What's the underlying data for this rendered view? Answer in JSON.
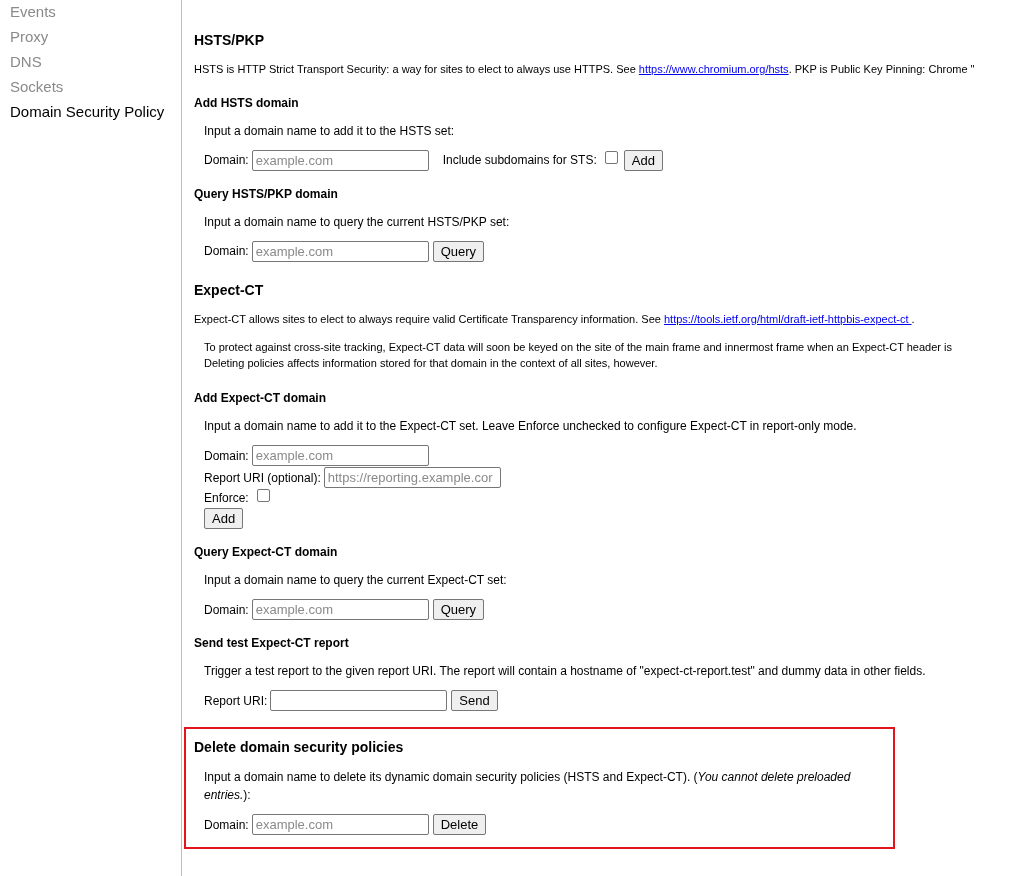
{
  "sidebar": {
    "items": [
      {
        "label": "Events",
        "selected": false
      },
      {
        "label": "Proxy",
        "selected": false
      },
      {
        "label": "DNS",
        "selected": false
      },
      {
        "label": "Sockets",
        "selected": false
      },
      {
        "label": "Domain Security Policy",
        "selected": true
      }
    ]
  },
  "sections": [
    {
      "highlighted": false,
      "blocks": [
        {
          "kind": "h2",
          "text": "HSTS/PKP"
        },
        {
          "kind": "intro",
          "before": "HSTS is HTTP Strict Transport Security: a way for sites to elect to always use HTTPS. See ",
          "link": "https://www.chromium.org/hsts",
          "after": ". PKP is Public Key Pinning: Chrome \""
        },
        {
          "kind": "h3",
          "text": "Add HSTS domain"
        },
        {
          "kind": "text",
          "text": "Input a domain name to add it to the HSTS set:"
        },
        {
          "kind": "form",
          "rows": [
            [
              {
                "kind": "label",
                "text": "Domain:"
              },
              {
                "kind": "input",
                "placeholder": "example.com"
              },
              {
                "kind": "gap"
              },
              {
                "kind": "label",
                "text": "Include subdomains for STS:"
              },
              {
                "kind": "checkbox",
                "checked": false
              },
              {
                "kind": "button",
                "text": "Add"
              }
            ]
          ]
        },
        {
          "kind": "h3",
          "text": "Query HSTS/PKP domain"
        },
        {
          "kind": "text",
          "text": "Input a domain name to query the current HSTS/PKP set:"
        },
        {
          "kind": "form",
          "rows": [
            [
              {
                "kind": "label",
                "text": "Domain:"
              },
              {
                "kind": "input",
                "placeholder": "example.com"
              },
              {
                "kind": "button",
                "text": "Query"
              }
            ]
          ]
        },
        {
          "kind": "h2",
          "text": "Expect-CT"
        },
        {
          "kind": "intro",
          "before": "Expect-CT allows sites to elect to always require valid Certificate Transparency information. See ",
          "link": "https://tools.ietf.org/html/draft-ietf-httpbis-expect-ct ",
          "after": "."
        },
        {
          "kind": "note",
          "lines": [
            "To protect against cross-site tracking, Expect-CT data will soon be keyed on the site of the main frame and innermost frame when an Expect-CT header is",
            "Deleting policies affects information stored for that domain in the context of all sites, however."
          ]
        },
        {
          "kind": "h3",
          "text": "Add Expect-CT domain"
        },
        {
          "kind": "text",
          "text": "Input a domain name to add it to the Expect-CT set. Leave Enforce unchecked to configure Expect-CT in report-only mode."
        },
        {
          "kind": "form",
          "rows": [
            [
              {
                "kind": "label",
                "text": "Domain:"
              },
              {
                "kind": "input",
                "placeholder": "example.com"
              }
            ],
            [
              {
                "kind": "label",
                "text": "Report URI (optional):"
              },
              {
                "kind": "input",
                "placeholder": "https://reporting.example.cor"
              }
            ],
            [
              {
                "kind": "label",
                "text": "Enforce:"
              },
              {
                "kind": "checkbox",
                "checked": false
              }
            ],
            [
              {
                "kind": "button",
                "text": "Add"
              }
            ]
          ]
        },
        {
          "kind": "h3",
          "text": "Query Expect-CT domain"
        },
        {
          "kind": "text",
          "text": "Input a domain name to query the current Expect-CT set:"
        },
        {
          "kind": "form",
          "rows": [
            [
              {
                "kind": "label",
                "text": "Domain:"
              },
              {
                "kind": "input",
                "placeholder": "example.com"
              },
              {
                "kind": "button",
                "text": "Query"
              }
            ]
          ]
        },
        {
          "kind": "h3",
          "text": "Send test Expect-CT report"
        },
        {
          "kind": "text",
          "text": "Trigger a test report to the given report URI. The report will contain a hostname of \"expect-ct-report.test\" and dummy data in other fields."
        },
        {
          "kind": "form",
          "rows": [
            [
              {
                "kind": "label",
                "text": "Report URI:"
              },
              {
                "kind": "input"
              },
              {
                "kind": "button",
                "text": "Send"
              }
            ]
          ]
        }
      ]
    },
    {
      "highlighted": true,
      "blocks": [
        {
          "kind": "h2",
          "text": "Delete domain security policies"
        },
        {
          "kind": "text",
          "text": "Input a domain name to delete its dynamic domain security policies (HSTS and Expect-CT). (*You cannot delete preloaded entries.*):"
        },
        {
          "kind": "form",
          "rows": [
            [
              {
                "kind": "label",
                "text": "Domain:"
              },
              {
                "kind": "input",
                "placeholder": "example.com"
              },
              {
                "kind": "button",
                "text": "Delete"
              }
            ]
          ]
        }
      ]
    }
  ]
}
